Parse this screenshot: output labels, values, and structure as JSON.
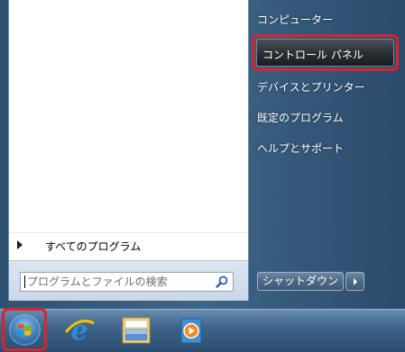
{
  "start_menu": {
    "left_pane": {
      "all_programs_label": "すべてのプログラム",
      "search_placeholder": "プログラムとファイルの検索"
    },
    "right_pane": {
      "items": [
        {
          "label": "コンピューター"
        },
        {
          "label": "コントロール パネル",
          "highlighted": true
        },
        {
          "label": "デバイスとプリンター"
        },
        {
          "label": "既定のプログラム"
        },
        {
          "label": "ヘルプとサポート"
        }
      ],
      "shutdown_label": "シャットダウン"
    },
    "highlight_color": "#e0202a"
  },
  "taskbar": {
    "items": [
      {
        "icon": "windows-start-orb-icon"
      },
      {
        "icon": "internet-explorer-icon"
      },
      {
        "icon": "windows-explorer-icon"
      },
      {
        "icon": "media-player-icon"
      }
    ]
  }
}
